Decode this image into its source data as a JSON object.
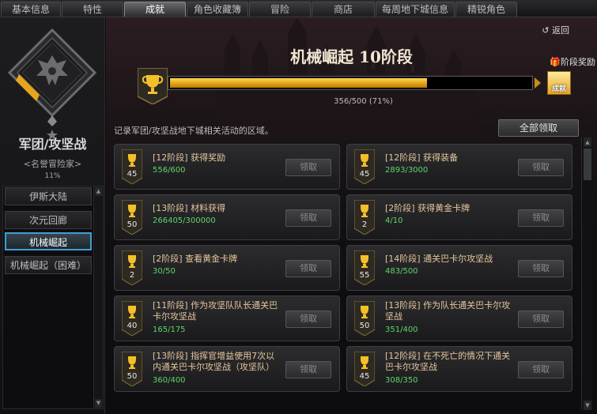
{
  "tabs": [
    {
      "label": "基本信息"
    },
    {
      "label": "特性"
    },
    {
      "label": "成就"
    },
    {
      "label": "角色收藏簿"
    },
    {
      "label": "冒险"
    },
    {
      "label": "商店"
    },
    {
      "label": "每周地下城信息"
    },
    {
      "label": "精锐角色"
    }
  ],
  "active_tab": "成就",
  "left": {
    "title": "军团/攻坚战",
    "subtitle": "<名誉冒险家>",
    "percent": "11%",
    "items": [
      {
        "label": "伊斯大陆"
      },
      {
        "label": "次元回廊"
      },
      {
        "label": "机械崛起"
      },
      {
        "label": "机械崛起（困难）"
      }
    ],
    "active_item": "机械崛起"
  },
  "main": {
    "back": "返回",
    "title": "机械崛起 10阶段",
    "stage_reward": "阶段奖励",
    "reward_badge": "成就",
    "progress": {
      "current": 356,
      "total": 500,
      "fraction": 0.712,
      "text": "356/500 (71%)"
    },
    "description": "记录军团/攻坚战地下城相关活动的区域。",
    "claim_all": "全部领取",
    "claim_label": "领取",
    "achievements": [
      {
        "title": "[12阶段] 获得奖励",
        "progress": "556/600",
        "badge": "45"
      },
      {
        "title": "[12阶段] 获得装备",
        "progress": "2893/3000",
        "badge": "45"
      },
      {
        "title": "[13阶段] 材料获得",
        "progress": "266405/300000",
        "badge": "50"
      },
      {
        "title": "[2阶段] 获得黄金卡牌",
        "progress": "4/10",
        "badge": "2"
      },
      {
        "title": "[2阶段] 查看黄金卡牌",
        "progress": "30/50",
        "badge": "2"
      },
      {
        "title": "[14阶段] 通关巴卡尔攻坚战",
        "progress": "483/500",
        "badge": "55"
      },
      {
        "title": "[11阶段] 作为攻坚队队长通关巴卡尔攻坚战",
        "progress": "165/175",
        "badge": "40"
      },
      {
        "title": "[13阶段] 作为队长通关巴卡尔攻坚战",
        "progress": "351/400",
        "badge": "50"
      },
      {
        "title": "[13阶段] 指挥官增益使用7次以内通关巴卡尔攻坚战（攻坚队）",
        "progress": "360/400",
        "badge": "50"
      },
      {
        "title": "[12阶段] 在不死亡的情况下通关巴卡尔攻坚战",
        "progress": "308/350",
        "badge": "45"
      }
    ]
  }
}
